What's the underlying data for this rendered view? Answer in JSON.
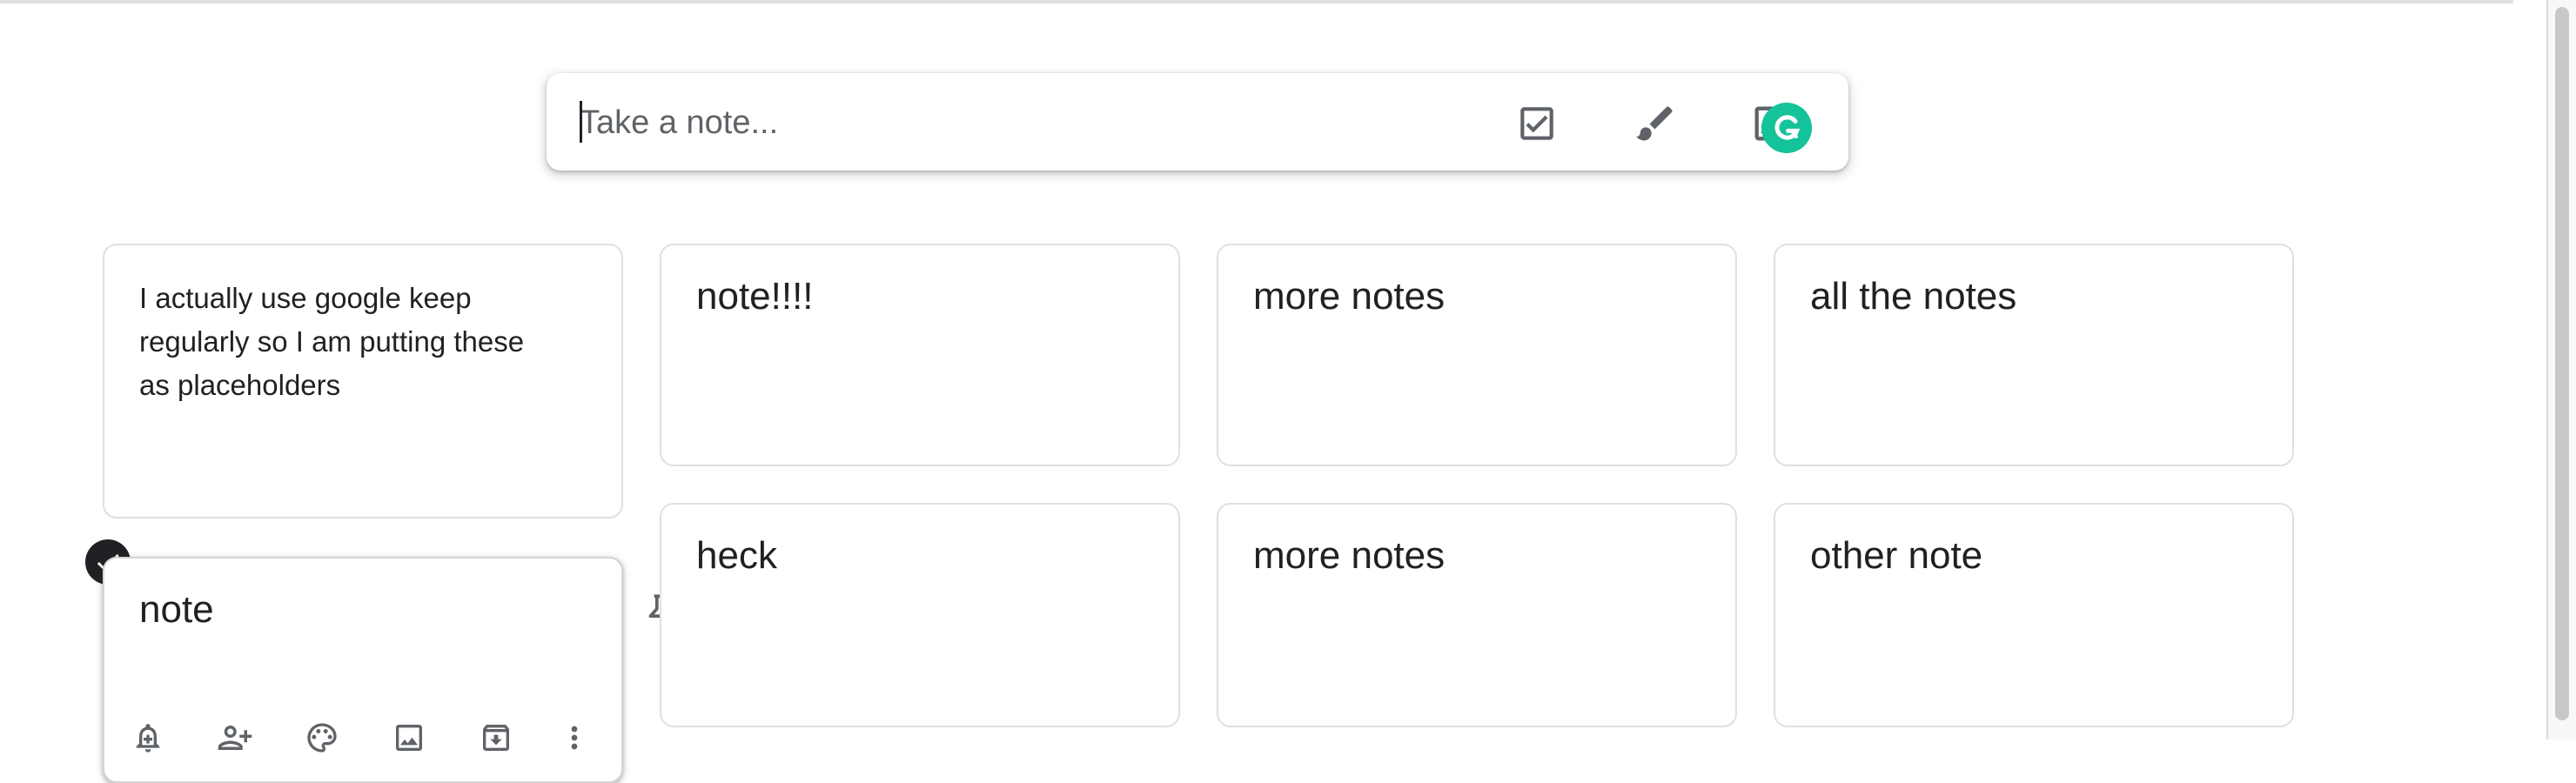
{
  "composer": {
    "placeholder": "Take a note...",
    "icons": [
      "checkbox-icon",
      "brush-icon",
      "image-icon",
      "grammarly-icon"
    ]
  },
  "notes": [
    {
      "title": "",
      "body": "I actually use google keep regularly so I am putting these as placeholders"
    },
    {
      "title": "note!!!!",
      "body": ""
    },
    {
      "title": "more notes",
      "body": ""
    },
    {
      "title": "all the notes",
      "body": ""
    },
    {
      "title": "note",
      "body": "",
      "selected": true
    },
    {
      "title": "heck",
      "body": ""
    },
    {
      "title": "more notes",
      "body": ""
    },
    {
      "title": "other note",
      "body": ""
    }
  ],
  "selected_note_toolbar": [
    "add-alert-icon",
    "collaborator-icon",
    "palette-icon",
    "image-icon",
    "archive-icon",
    "more-vert-icon"
  ],
  "colors": {
    "grammarly": "#15c39a",
    "card_border": "#e0e0e0",
    "text": "#202124",
    "icon": "#5f6368"
  }
}
